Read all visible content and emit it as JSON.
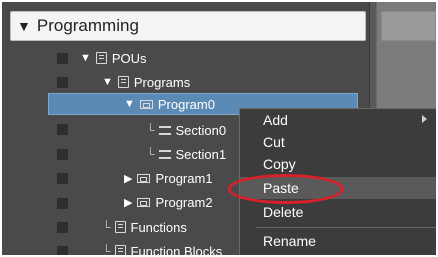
{
  "header": {
    "title": "Programming"
  },
  "tree": {
    "pous": "POUs",
    "programs": "Programs",
    "program0": "Program0",
    "section0": "Section0",
    "section1": "Section1",
    "program1": "Program1",
    "program2": "Program2",
    "functions": "Functions",
    "function_blocks": "Function Blocks"
  },
  "context_menu": {
    "items": [
      {
        "label": "Add",
        "submenu": true
      },
      {
        "label": "Cut"
      },
      {
        "label": "Copy"
      },
      {
        "label": "Paste",
        "highlighted": true
      },
      {
        "label": "Delete"
      },
      {
        "label": "Rename"
      }
    ]
  },
  "colors": {
    "selection": "#5b8bb5",
    "highlight_ring": "#d8202a",
    "panel_bg": "#4a4a4a"
  }
}
